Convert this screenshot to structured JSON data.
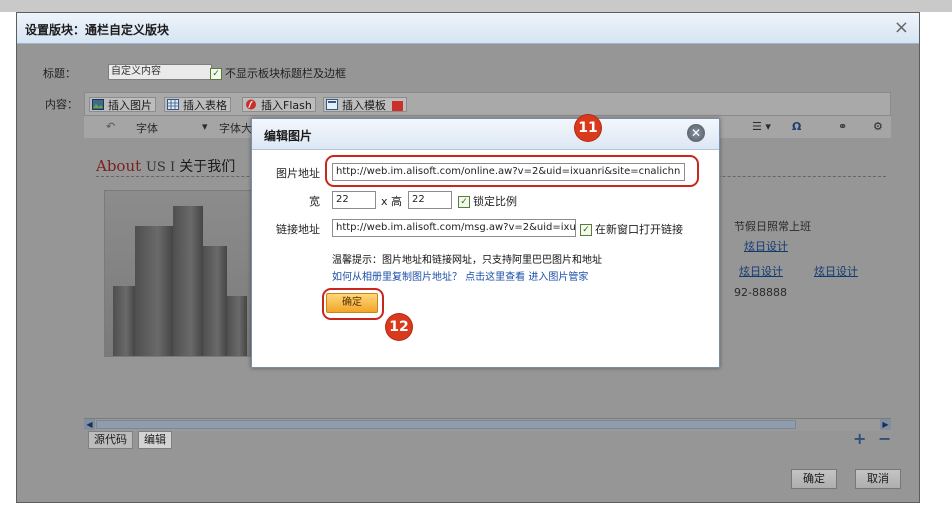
{
  "dialog": {
    "title": "设置版块：通栏自定义版块",
    "close_icon": "×",
    "title_label": "标题：",
    "title_value": "自定义内容",
    "hide_title_label": "不显示板块标题栏及边框",
    "content_label": "内容：",
    "toolbar": {
      "insert_image": "插入图片",
      "insert_table": "插入表格",
      "insert_flash": "插入Flash",
      "insert_template": "插入模板",
      "font": "字体",
      "font_size": "字体大小",
      "omega": "Ω"
    },
    "editor": {
      "about": "About",
      "us": "US",
      "sep": " I ",
      "about_cn": "关于我们",
      "right_text_1": "节假日照常上班",
      "link_1": "炫日设计",
      "link_2": "炫日设计",
      "link_3": "炫日设计",
      "phone": "92-88888"
    },
    "tabs": [
      "源代码",
      "编辑"
    ],
    "plus": "+",
    "minus": "−",
    "ok": "确定",
    "cancel": "取消"
  },
  "modal": {
    "title": "编辑图片",
    "image_url_label": "图片地址",
    "image_url_value": "http://web.im.alisoft.com/online.aw?v=2&uid=ixuanri&site=cnalichn",
    "width_label": "宽",
    "width_value": "22",
    "x_height_label": "x 高",
    "height_value": "22",
    "lock_ratio_label": "锁定比例",
    "link_url_label": "链接地址",
    "link_url_value": "http://web.im.alisoft.com/msg.aw?v=2&uid=ixu",
    "new_window_label": "在新窗口打开链接",
    "hint": "温馨提示：图片地址和链接网址，只支持阿里巴巴图片和地址",
    "hint_link": "如何从相册里复制图片地址？ 点击这里查看 进入图片管家",
    "ok": "确定"
  },
  "annotations": {
    "badge_11": "11",
    "badge_12": "12"
  }
}
